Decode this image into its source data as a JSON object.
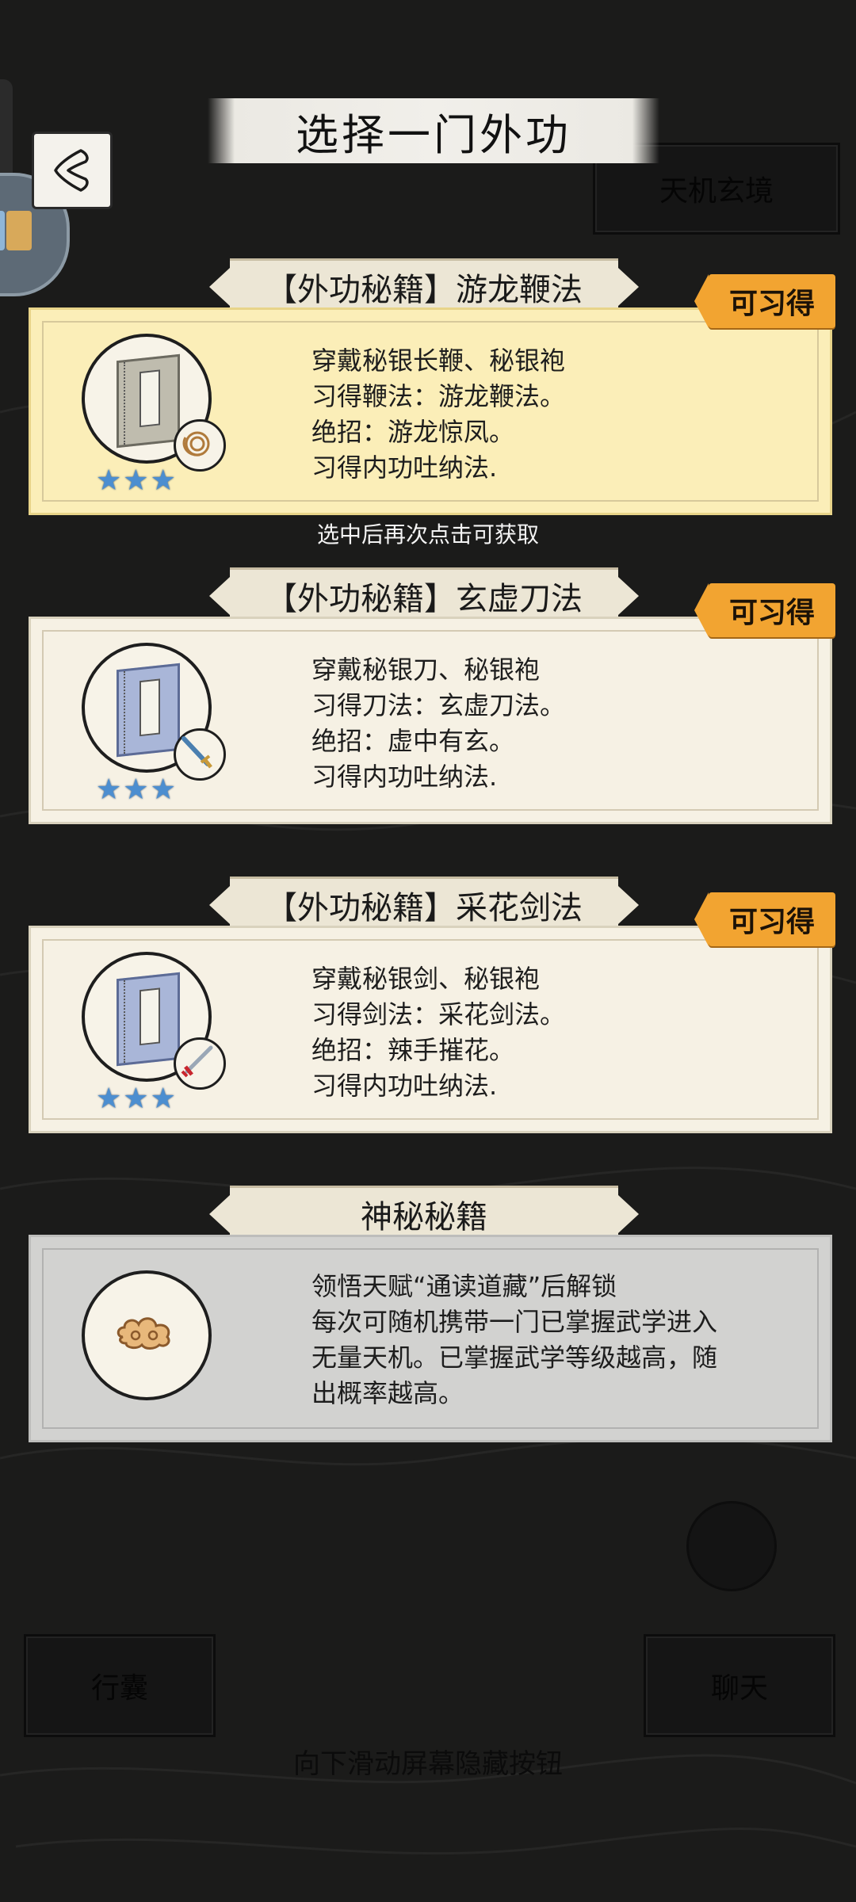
{
  "title": "选择一门外功",
  "back_button": "back",
  "background": {
    "tianji_button": "天机玄境",
    "bag_button": "行囊",
    "chat_button": "聊天",
    "hint": "向下滑动屏幕隐藏按钮"
  },
  "tap_hint": "选中后再次点击可获取",
  "cards": [
    {
      "header": "【外功秘籍】游龙鞭法",
      "badge": "可习得",
      "lines": [
        "穿戴秘银长鞭、秘银袍",
        "习得鞭法：游龙鞭法。",
        "绝招：游龙惊凤。",
        "习得内功吐纳法."
      ],
      "stars": 3,
      "selected": true
    },
    {
      "header": "【外功秘籍】玄虚刀法",
      "badge": "可习得",
      "lines": [
        "穿戴秘银刀、秘银袍",
        "习得刀法：玄虚刀法。",
        "绝招：虚中有玄。",
        "习得内功吐纳法."
      ],
      "stars": 3,
      "selected": false
    },
    {
      "header": "【外功秘籍】采花剑法",
      "badge": "可习得",
      "lines": [
        "穿戴秘银剑、秘银袍",
        "习得剑法：采花剑法。",
        "绝招：辣手摧花。",
        "习得内功吐纳法."
      ],
      "stars": 3,
      "selected": false
    }
  ],
  "mystery": {
    "header": "神秘秘籍",
    "lines": [
      "领悟天赋“通读道藏”后解锁",
      "每次可随机携带一门已掌握武学进入",
      "无量天机。已掌握武学等级越高，随",
      "出概率越高。"
    ]
  },
  "icons": {
    "star": "star-icon",
    "book": "book-icon",
    "whip": "whip-icon",
    "saber": "saber-icon",
    "sword": "sword-icon",
    "cloud": "cloud-icon"
  },
  "colors": {
    "badge": "#f2a431",
    "selected_card": "#fbeeb8",
    "card": "#f6f1e4",
    "star": "#4c8ed0"
  }
}
